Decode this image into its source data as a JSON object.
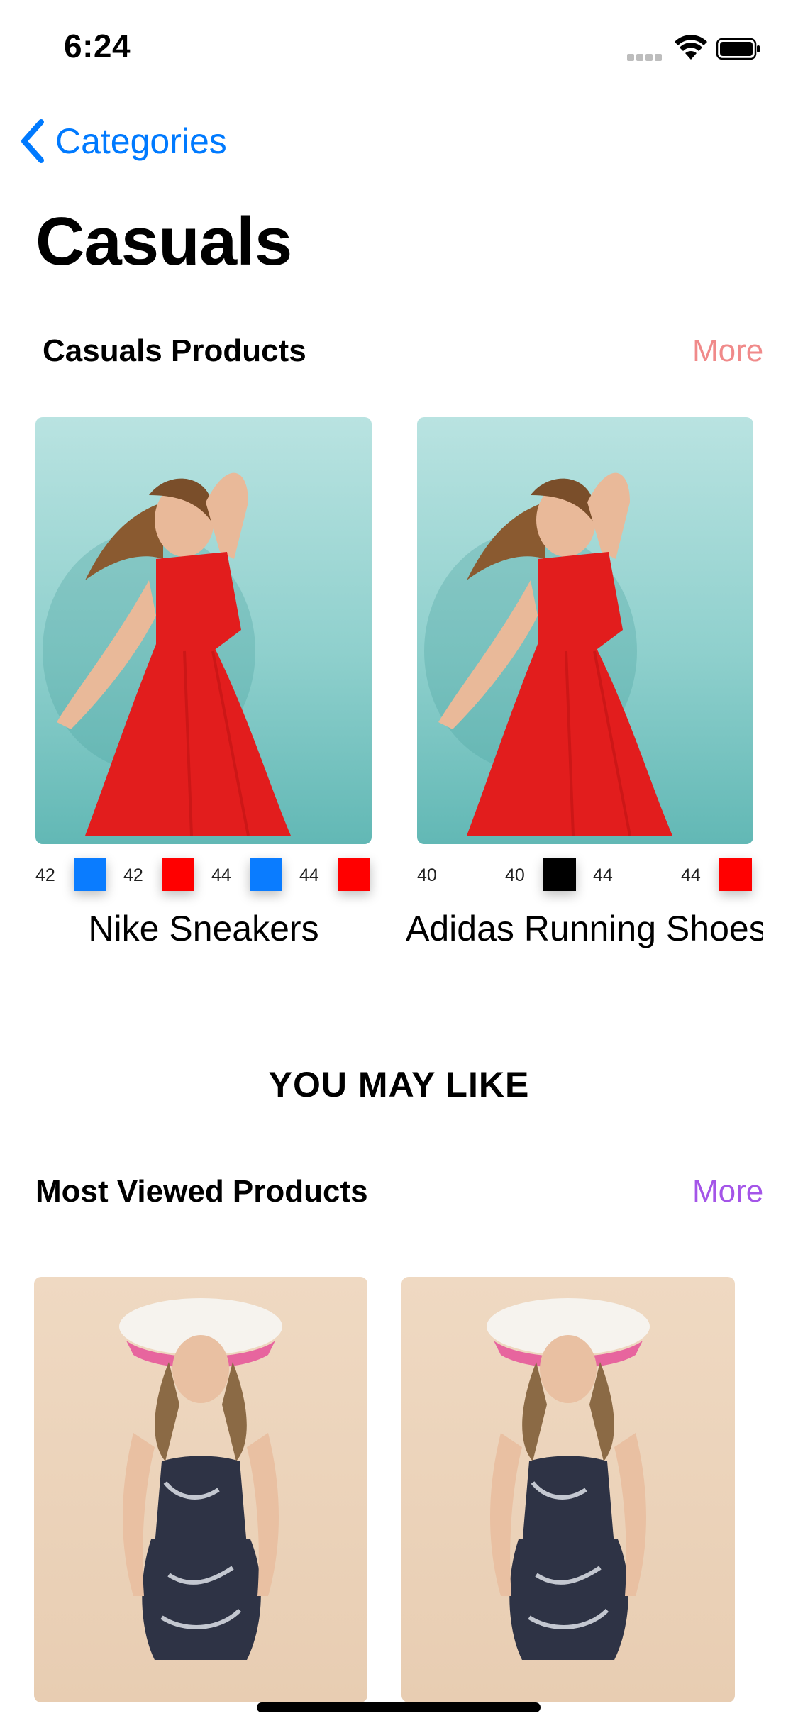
{
  "status_bar": {
    "time": "6:24"
  },
  "nav": {
    "back_label": "Categories",
    "title": "Casuals"
  },
  "section1": {
    "title": "Casuals Products",
    "more": "More",
    "more_color": "#f08a8a",
    "products": [
      {
        "name": "Nike Sneakers",
        "variants": [
          {
            "size": "42",
            "color": "#0a7cff"
          },
          {
            "size": "42",
            "color": "#ff0000"
          },
          {
            "size": "44",
            "color": "#0a7cff"
          },
          {
            "size": "44",
            "color": "#ff0000"
          }
        ]
      },
      {
        "name": "Adidas Running Shoes",
        "variants": [
          {
            "size": "40",
            "color": "#ffffff"
          },
          {
            "size": "40",
            "color": "#000000"
          },
          {
            "size": "44",
            "color": "#ffffff"
          },
          {
            "size": "44",
            "color": "#ff0000"
          }
        ]
      }
    ]
  },
  "you_may_like": "YOU MAY LIKE",
  "section2": {
    "title": "Most Viewed Products",
    "more": "More",
    "more_color": "#a455e8"
  }
}
